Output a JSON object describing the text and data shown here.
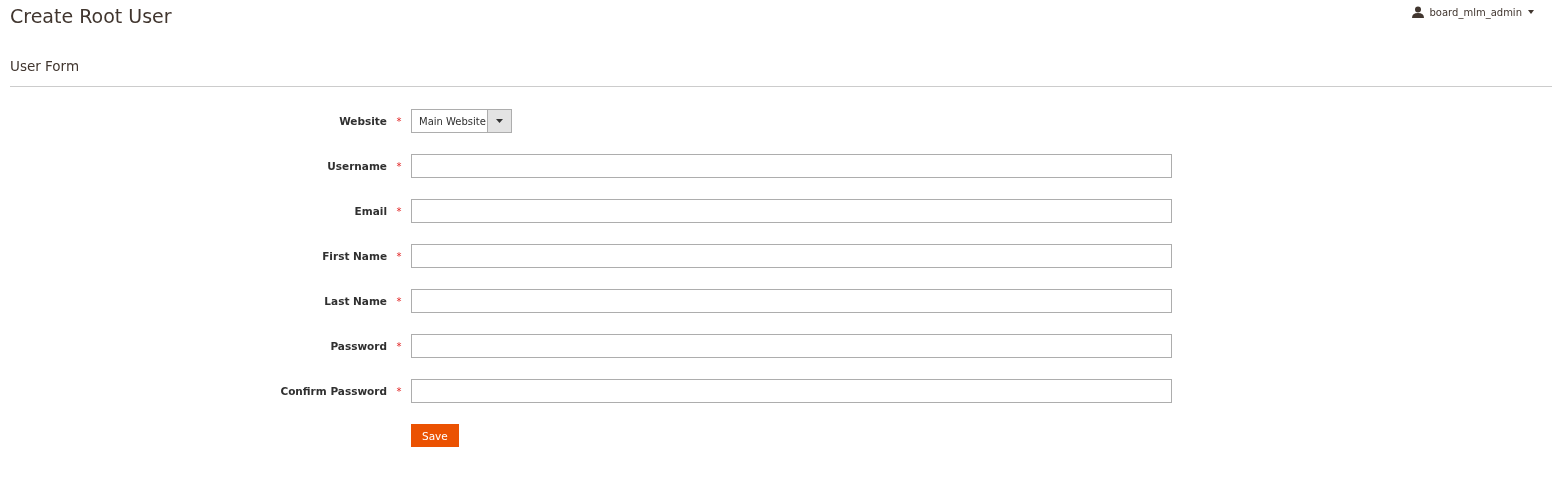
{
  "page_title": "Create Root User",
  "account": {
    "name": "board_mlm_admin"
  },
  "section_title": "User Form",
  "fields": [
    {
      "kind": "select",
      "label": "Website",
      "mark": "*",
      "value": "Main Website"
    },
    {
      "kind": "text",
      "label": "Username",
      "mark": "*"
    },
    {
      "kind": "text",
      "label": "Email",
      "mark": "*"
    },
    {
      "kind": "text",
      "label": "First Name",
      "mark": "*"
    },
    {
      "kind": "text",
      "label": "Last Name",
      "mark": "*"
    },
    {
      "kind": "password",
      "label": "Password",
      "mark": "*"
    },
    {
      "kind": "password",
      "label": "Confirm Password",
      "mark": "*"
    }
  ],
  "save_button": "Save"
}
